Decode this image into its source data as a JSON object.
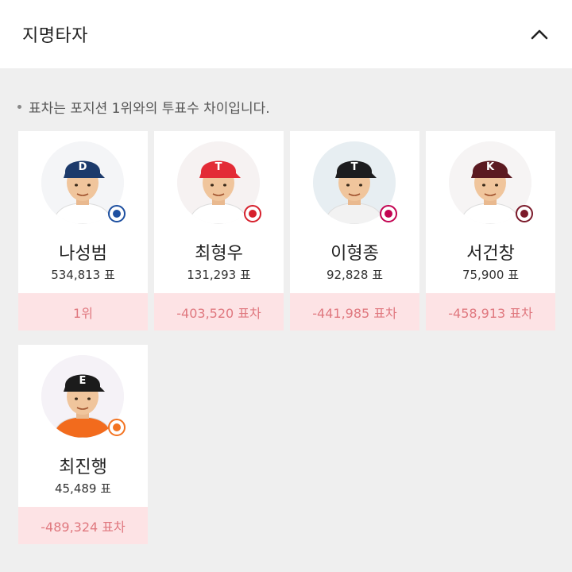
{
  "header": {
    "title": "지명타자"
  },
  "note": "표차는 포지션 1위와의 투표수 차이입니다.",
  "players": [
    {
      "name": "나성범",
      "votes": "534,813 표",
      "diff": "1위",
      "cap": "#1c3a6b",
      "capLetter": "D",
      "shirt": "#ffffff",
      "bg": "#f4f5f7",
      "logo": "nc-dinos-logo-icon",
      "logoColor": "#1d4fa0"
    },
    {
      "name": "최형우",
      "votes": "131,293 표",
      "diff": "-403,520 표차",
      "cap": "#e32b36",
      "capLetter": "T",
      "shirt": "#ffffff",
      "bg": "#f6f2f2",
      "logo": "kia-tigers-logo-icon",
      "logoColor": "#d6202c"
    },
    {
      "name": "이형종",
      "votes": "92,828 표",
      "diff": "-441,985 표차",
      "cap": "#1d1d1f",
      "capLetter": "T",
      "shirt": "#f2f2f2",
      "bg": "#e7eef2",
      "logo": "lg-twins-logo-icon",
      "logoColor": "#c30452"
    },
    {
      "name": "서건창",
      "votes": "75,900 표",
      "diff": "-458,913 표차",
      "cap": "#5b1a21",
      "capLetter": "K",
      "shirt": "#ffffff",
      "bg": "#f6f4f4",
      "logo": "nexen-heroes-logo-icon",
      "logoColor": "#7b1a2a"
    },
    {
      "name": "최진행",
      "votes": "45,489 표",
      "diff": "-489,324 표차",
      "cap": "#1b1b1b",
      "capLetter": "E",
      "shirt": "#f26b1d",
      "bg": "#f5f2f7",
      "logo": "hanwha-eagles-logo-icon",
      "logoColor": "#f37321"
    }
  ]
}
